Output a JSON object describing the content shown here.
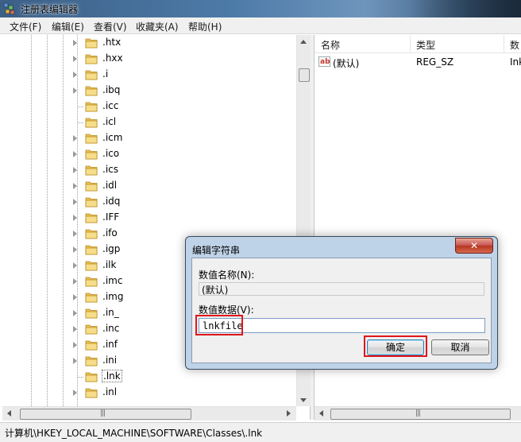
{
  "window": {
    "title": "注册表编辑器"
  },
  "menu": [
    "文件(F)",
    "编辑(E)",
    "查看(V)",
    "收藏夹(A)",
    "帮助(H)"
  ],
  "tree": {
    "items": [
      ".htx",
      ".hxx",
      ".i",
      ".ibq",
      ".icc",
      ".icl",
      ".icm",
      ".ico",
      ".ics",
      ".idl",
      ".idq",
      ".IFF",
      ".ifo",
      ".igp",
      ".ilk",
      ".imc",
      ".img",
      ".in_",
      ".inc",
      ".inf",
      ".ini",
      ".lnk",
      ".inl"
    ],
    "selected": ".lnk"
  },
  "list": {
    "columns": [
      "名称",
      "类型",
      "数"
    ],
    "rows": [
      {
        "name": "(默认)",
        "type": "REG_SZ",
        "data": "Ink"
      }
    ]
  },
  "status": {
    "path": "计算机\\HKEY_LOCAL_MACHINE\\SOFTWARE\\Classes\\.lnk"
  },
  "dialog": {
    "title": "编辑字符串",
    "close_label": "✕",
    "name_label": "数值名称(N):",
    "name_value": "(默认)",
    "data_label": "数值数据(V):",
    "data_value": "lnkfile",
    "ok_label": "确定",
    "cancel_label": "取消"
  },
  "colors": {
    "highlight": "#e0161b",
    "title_bar": "#4d7ba8",
    "dialog_frame": "#bfd3e8"
  },
  "icons": {
    "app": "registry-editor-icon",
    "folder": "folder-icon",
    "value": "string-value-icon"
  }
}
